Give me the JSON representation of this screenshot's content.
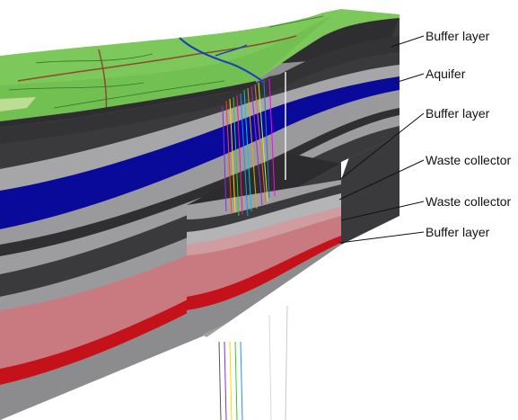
{
  "labels": [
    {
      "id": "buffer-top",
      "text": "Buffer layer"
    },
    {
      "id": "aquifer",
      "text": "Aquifer"
    },
    {
      "id": "buffer-mid",
      "text": "Buffer layer"
    },
    {
      "id": "waste-upper",
      "text": "Waste collector"
    },
    {
      "id": "waste-lower",
      "text": "Waste collector"
    },
    {
      "id": "buffer-bottom",
      "text": "Buffer layer"
    }
  ],
  "colors": {
    "terrain": "#7cc85a",
    "buffer_dark": "#3a3a3c",
    "buffer_gray": "#8f8f92",
    "aquifer": "#0a0a9a",
    "waste_pink": "#c97a80",
    "waste_red": "#c4111a",
    "background": "#ffffff"
  }
}
